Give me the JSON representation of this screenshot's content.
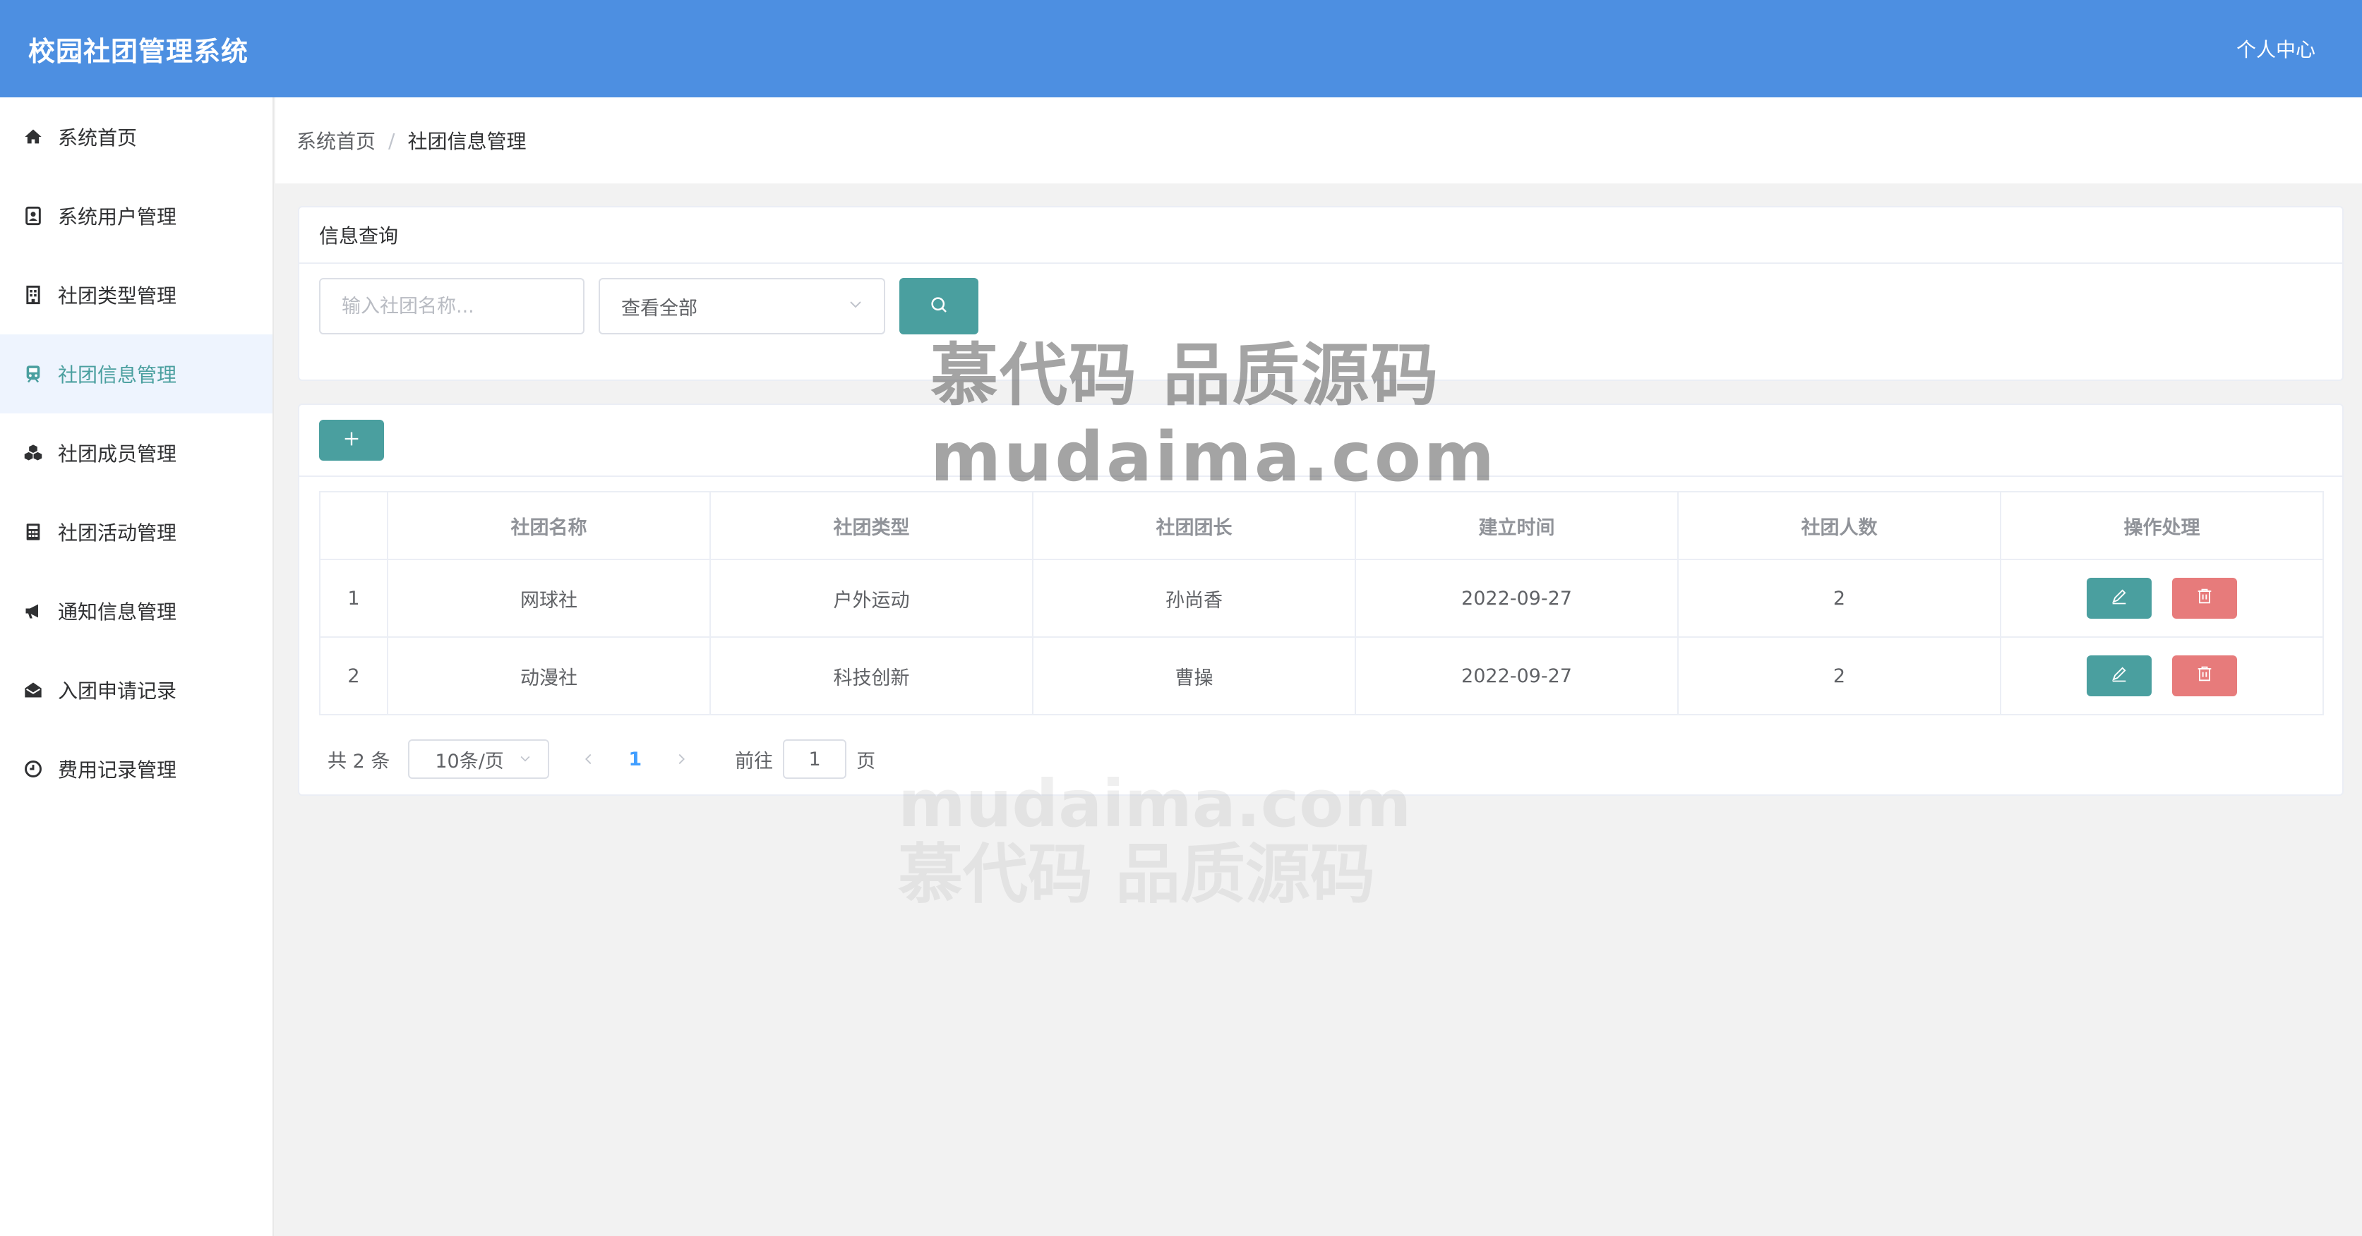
{
  "header": {
    "title": "校园社团管理系统",
    "user_center": "个人中心"
  },
  "sidebar": {
    "items": [
      {
        "label": "系统首页",
        "icon": "home-icon"
      },
      {
        "label": "系统用户管理",
        "icon": "user-card-icon"
      },
      {
        "label": "社团类型管理",
        "icon": "building-icon"
      },
      {
        "label": "社团信息管理",
        "icon": "train-icon",
        "active": true
      },
      {
        "label": "社团成员管理",
        "icon": "cubes-icon"
      },
      {
        "label": "社团活动管理",
        "icon": "calculator-icon"
      },
      {
        "label": "通知信息管理",
        "icon": "bullhorn-icon"
      },
      {
        "label": "入团申请记录",
        "icon": "envelope-open-icon"
      },
      {
        "label": "费用记录管理",
        "icon": "clock-icon"
      }
    ]
  },
  "breadcrumb": {
    "home": "系统首页",
    "separator": "/",
    "current": "社团信息管理"
  },
  "query": {
    "title": "信息查询",
    "name_placeholder": "输入社团名称...",
    "type_select": "查看全部"
  },
  "table": {
    "columns": [
      "",
      "社团名称",
      "社团类型",
      "社团团长",
      "建立时间",
      "社团人数",
      "操作处理"
    ],
    "rows": [
      {
        "index": "1",
        "name": "网球社",
        "type": "户外运动",
        "leader": "孙尚香",
        "created": "2022-09-27",
        "members": "2"
      },
      {
        "index": "2",
        "name": "动漫社",
        "type": "科技创新",
        "leader": "曹操",
        "created": "2022-09-27",
        "members": "2"
      }
    ]
  },
  "pagination": {
    "total": "共 2 条",
    "page_size": "10条/页",
    "current_page": "1",
    "goto_label": "前往",
    "goto_value": "1",
    "goto_suffix": "页"
  },
  "watermark": {
    "line1": "慕代码 品质源码",
    "line2": "mudaima.com",
    "faded_line1": "mudaima.com",
    "faded_line2": "慕代码 品质源码"
  },
  "colors": {
    "header": "#4d8fe1",
    "accent": "#4a9f9f",
    "danger": "#e77b7b",
    "active_bg": "#eef4fe",
    "page_link": "#409eff"
  }
}
